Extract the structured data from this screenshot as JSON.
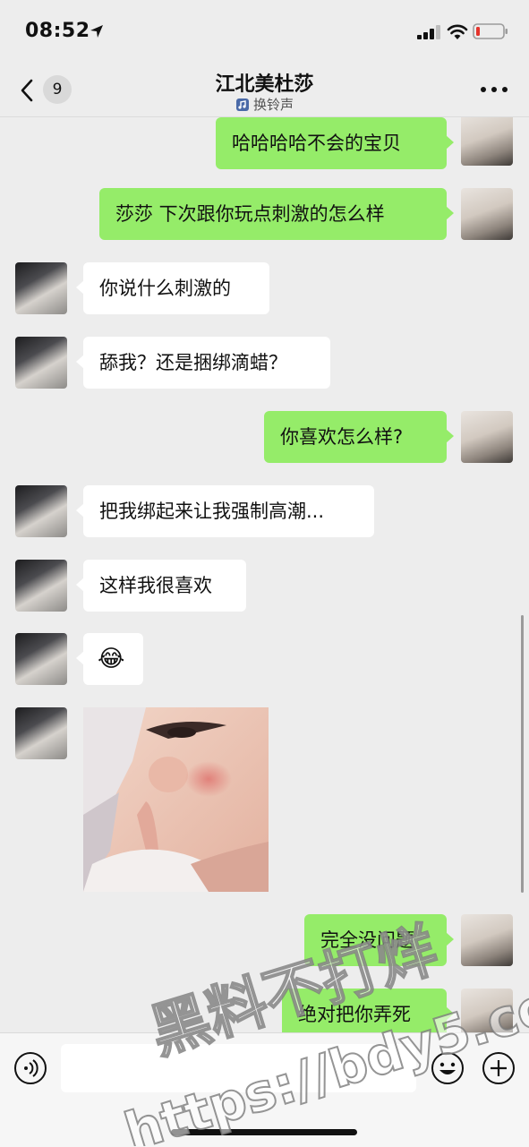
{
  "status_bar": {
    "time": "08:52"
  },
  "header": {
    "unread_count": "9",
    "title": "江北美杜莎",
    "subtitle": "换铃声"
  },
  "messages": [
    {
      "from": "me",
      "text": "哈哈哈哈不会的宝贝"
    },
    {
      "from": "me",
      "text": "莎莎 下次跟你玩点刺激的怎么样"
    },
    {
      "from": "other",
      "text": "你说什么刺激的"
    },
    {
      "from": "other",
      "text": "舔我？还是捆绑滴蜡？"
    },
    {
      "from": "me",
      "text": "你喜欢怎么样?"
    },
    {
      "from": "other",
      "text": "把我绑起来让我强制高潮..."
    },
    {
      "from": "other",
      "text": "这样我很喜欢"
    },
    {
      "from": "other",
      "text": "😂"
    },
    {
      "from": "other",
      "text": "",
      "type": "image"
    },
    {
      "from": "me",
      "text": "完全没问题"
    },
    {
      "from": "me",
      "text": "绝对把你弄死"
    }
  ],
  "input": {
    "value": "",
    "placeholder": ""
  },
  "watermark": {
    "line1": "黑料不打烊",
    "line2": "https://bdy5.co"
  },
  "colors": {
    "my_bubble": "#95ec69",
    "other_bubble": "#ffffff",
    "background": "#ededed"
  }
}
